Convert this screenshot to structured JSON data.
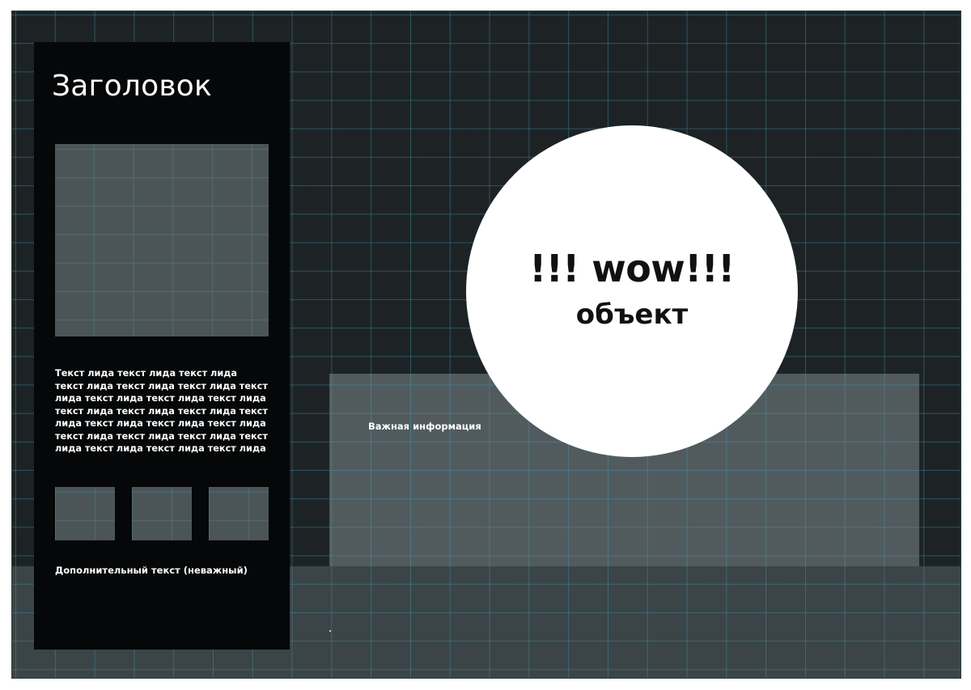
{
  "sidebar": {
    "title": "Заголовок",
    "lead_text": "Текст лида текст лида текст лида текст лида текст лида текст лида текст лида текст лида текст лида текст лида текст лида текст лида текст лида текст лида текст лида текст лида текст лида текст лида текст лида текст лида текст лида текст лида текст лида текст лида",
    "extra_text": "Дополнительный текст (неважный)"
  },
  "info_panel": {
    "label": "Важная информация"
  },
  "highlight": {
    "main_text": "!!! wow!!!",
    "sub_text": "объект"
  },
  "colors": {
    "background": "#1d2325",
    "grid_lines": "#46a0c8",
    "sidebar": "#050708",
    "placeholder": "#4b5558",
    "info_panel": "#515b5d",
    "circle": "#ffffff"
  }
}
